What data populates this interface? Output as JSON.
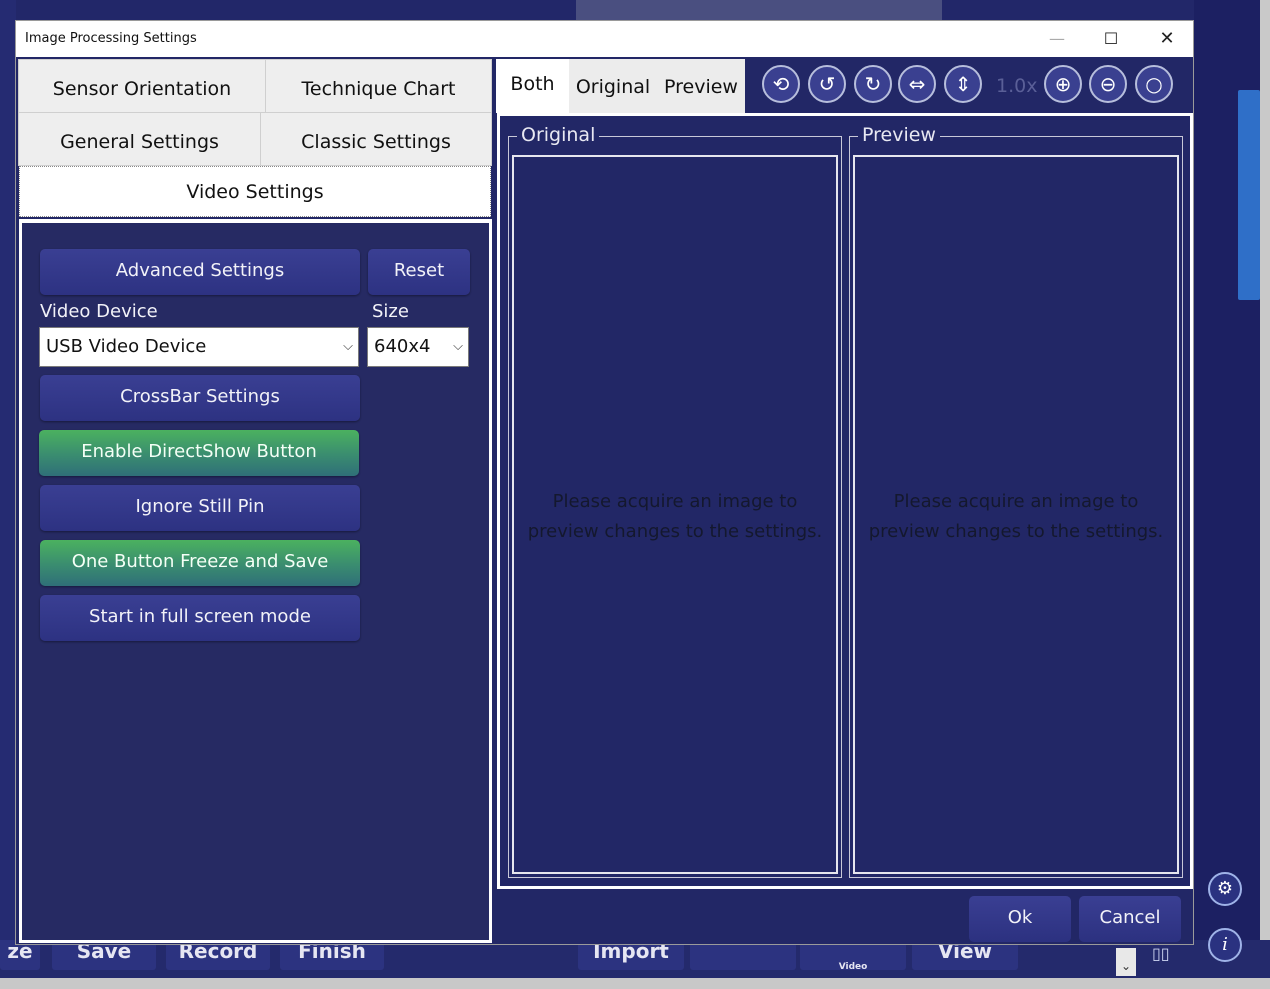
{
  "background": {
    "bottom_buttons": [
      "ze",
      "Save",
      "Record",
      "Finish",
      "Import",
      "View"
    ],
    "video_icon_label": "Video"
  },
  "dialog": {
    "title": "Image Processing Settings",
    "window_controls": {
      "minimize": "—",
      "maximize": "☐",
      "close": "✕"
    }
  },
  "left_tabs": {
    "sensor_orientation": "Sensor Orientation",
    "technique_chart": "Technique Chart",
    "general_settings": "General Settings",
    "classic_settings": "Classic Settings",
    "video_settings": "Video Settings"
  },
  "video_settings": {
    "advanced_settings": "Advanced Settings",
    "reset": "Reset",
    "video_device_label": "Video Device",
    "video_device_value": "USB Video Device",
    "size_label": "Size",
    "size_value": "640x4",
    "crossbar_settings": "CrossBar Settings",
    "enable_directshow": "Enable DirectShow Button",
    "ignore_still_pin": "Ignore Still Pin",
    "one_button_freeze": "One Button Freeze and Save",
    "start_full_screen": "Start in full screen mode"
  },
  "view_tabs": {
    "both": "Both",
    "original": "Original",
    "preview": "Preview"
  },
  "toolbar": {
    "zoom_level": "1.0x"
  },
  "preview": {
    "original_title": "Original",
    "preview_title": "Preview",
    "placeholder_line1": "Please acquire an image to",
    "placeholder_line2": "preview changes to the settings."
  },
  "footer": {
    "ok": "Ok",
    "cancel": "Cancel"
  },
  "colors": {
    "dialog_bg": "#222766",
    "button_bg": "#343a8c",
    "green_button": "#44a466"
  }
}
